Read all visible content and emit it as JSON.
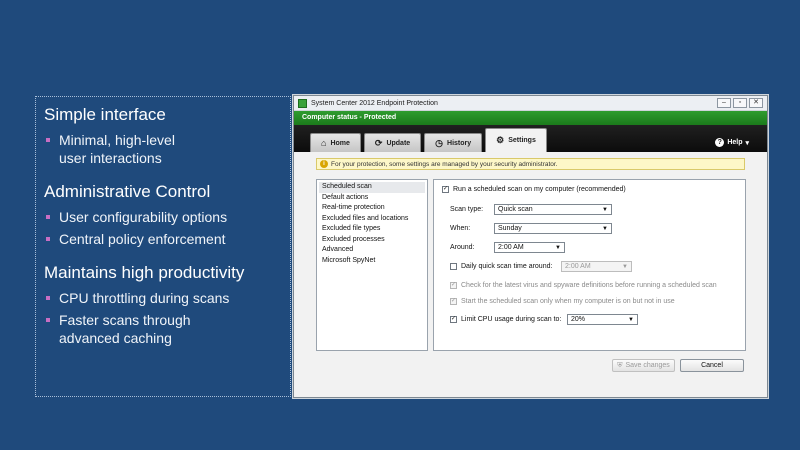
{
  "slide": {
    "sections": [
      {
        "heading": "Simple interface",
        "bullets": [
          "Minimal, high-level user interactions"
        ]
      },
      {
        "heading": "Administrative Control",
        "bullets": [
          "User configurability options",
          "Central policy enforcement"
        ]
      },
      {
        "heading": "Maintains high productivity",
        "bullets": [
          "CPU throttling during scans",
          "Faster scans through advanced caching"
        ]
      }
    ]
  },
  "window": {
    "title": "System Center 2012 Endpoint Protection",
    "status": "Computer status - Protected",
    "tabs": [
      {
        "label": "Home",
        "icon": "house-icon"
      },
      {
        "label": "Update",
        "icon": "update-icon"
      },
      {
        "label": "History",
        "icon": "history-icon"
      },
      {
        "label": "Settings",
        "icon": "gear-icon"
      }
    ],
    "help": "Help",
    "notice": "For your protection, some settings are managed by your security administrator.",
    "nav_items": [
      "Scheduled scan",
      "Default actions",
      "Real-time protection",
      "Excluded files and locations",
      "Excluded file types",
      "Excluded processes",
      "Advanced",
      "Microsoft SpyNet"
    ],
    "settings": {
      "run_scheduled": "Run a scheduled scan on my computer (recommended)",
      "scan_type_label": "Scan type:",
      "scan_type_value": "Quick scan",
      "when_label": "When:",
      "when_value": "Sunday",
      "around_label": "Around:",
      "around_value": "2:00 AM",
      "daily_quick": "Daily quick scan time around:",
      "daily_quick_value": "2:00 AM",
      "check_definitions": "Check for the latest virus and spyware definitions before running a scheduled scan",
      "start_only_idle": "Start the scheduled scan only when my computer is on but not in use",
      "limit_cpu": "Limit CPU usage during scan to:",
      "limit_cpu_value": "20%"
    },
    "save_label": "Save changes",
    "cancel_label": "Cancel"
  }
}
